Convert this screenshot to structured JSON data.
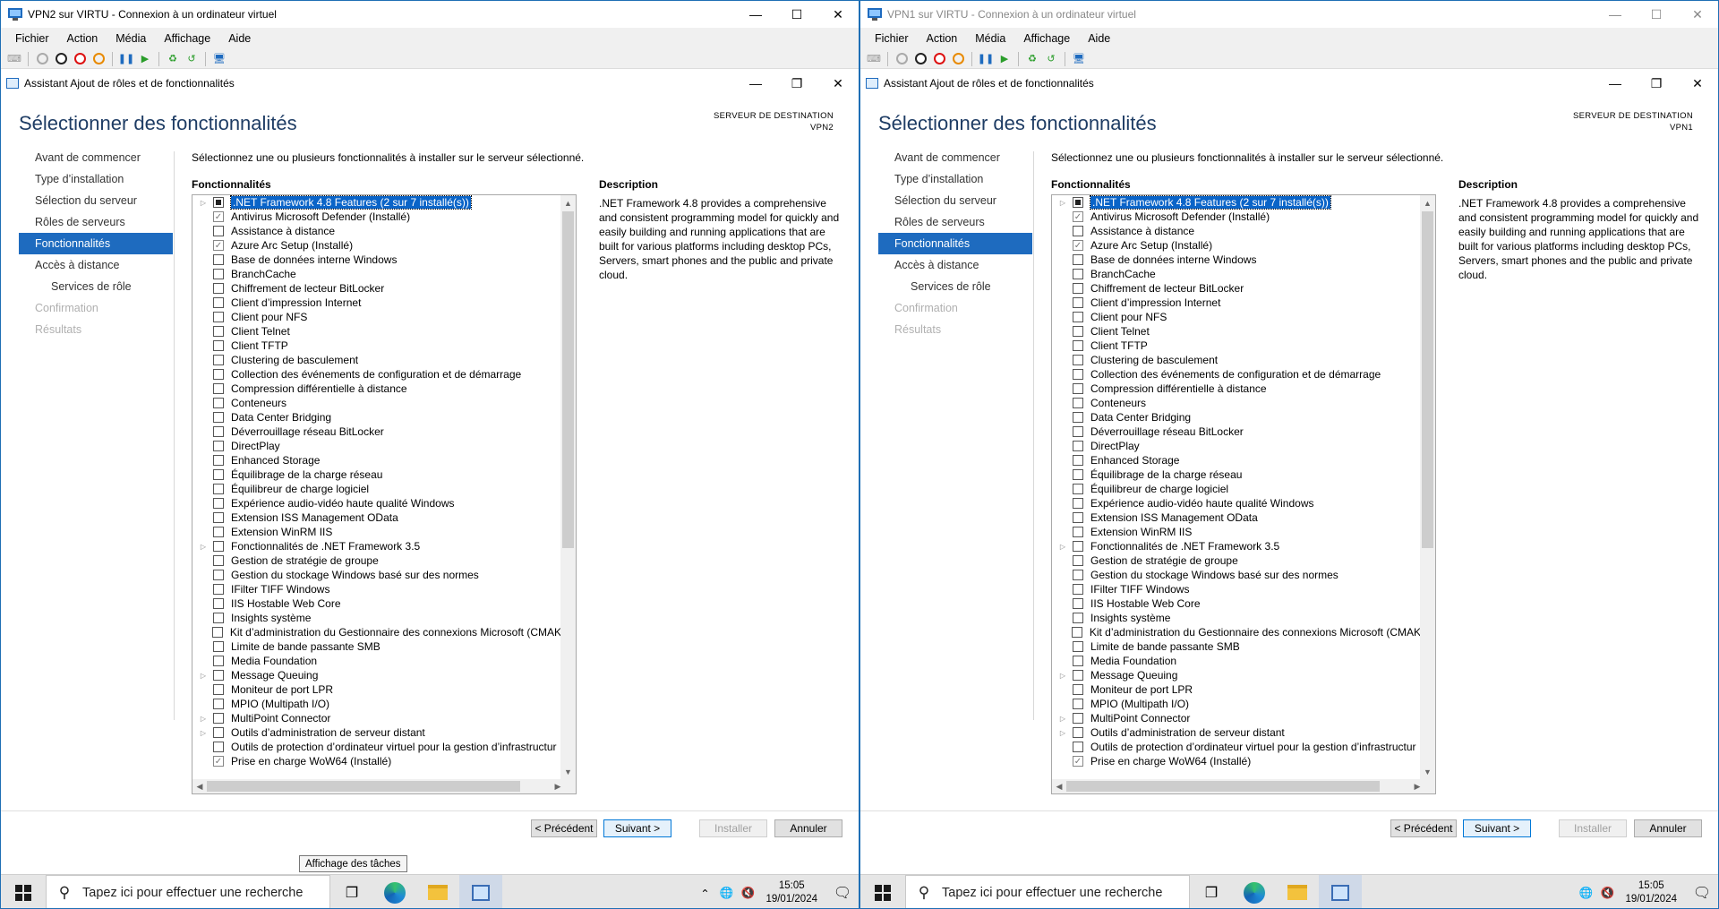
{
  "vm_windows": [
    {
      "title": "VPN2 sur VIRTU - Connexion à un ordinateur virtuel",
      "dest_value": "VPN2",
      "clock_time": "15:05",
      "clock_date": "19/01/2024"
    },
    {
      "title": "VPN1 sur VIRTU - Connexion à un ordinateur virtuel",
      "dest_value": "VPN1",
      "clock_time": "15:05",
      "clock_date": "19/01/2024"
    }
  ],
  "menu": [
    "Fichier",
    "Action",
    "Média",
    "Affichage",
    "Aide"
  ],
  "wizard": {
    "title": "Assistant Ajout de rôles et de fonctionnalités",
    "page_title": "Sélectionner des fonctionnalités",
    "dest_label": "SERVEUR DE DESTINATION",
    "intro": "Sélectionnez une ou plusieurs fonctionnalités à installer sur le serveur sélectionné.",
    "features_heading": "Fonctionnalités",
    "description_heading": "Description",
    "description": ".NET Framework 4.8 provides a comprehensive and consistent programming model for quickly and easily building and running applications that are built for various platforms including desktop PCs, Servers, smart phones and the public and private cloud.",
    "nav": [
      {
        "label": "Avant de commencer",
        "state": "normal"
      },
      {
        "label": "Type d’installation",
        "state": "normal"
      },
      {
        "label": "Sélection du serveur",
        "state": "normal"
      },
      {
        "label": "Rôles de serveurs",
        "state": "normal"
      },
      {
        "label": "Fonctionnalités",
        "state": "active"
      },
      {
        "label": "Accès à distance",
        "state": "normal"
      },
      {
        "label": "Services de rôle",
        "state": "sub"
      },
      {
        "label": "Confirmation",
        "state": "disabled"
      },
      {
        "label": "Résultats",
        "state": "disabled"
      }
    ],
    "features": [
      {
        "label": ".NET Framework 4.8 Features (2 sur 7 installé(s))",
        "check": "partial",
        "expand": true,
        "selected": true
      },
      {
        "label": "Antivirus Microsoft Defender (Installé)",
        "check": "installed",
        "expand": false
      },
      {
        "label": "Assistance à distance",
        "check": "none",
        "expand": false
      },
      {
        "label": "Azure Arc Setup (Installé)",
        "check": "installed",
        "expand": false
      },
      {
        "label": "Base de données interne Windows",
        "check": "none",
        "expand": false
      },
      {
        "label": "BranchCache",
        "check": "none",
        "expand": false
      },
      {
        "label": "Chiffrement de lecteur BitLocker",
        "check": "none",
        "expand": false
      },
      {
        "label": "Client d’impression Internet",
        "check": "none",
        "expand": false
      },
      {
        "label": "Client pour NFS",
        "check": "none",
        "expand": false
      },
      {
        "label": "Client Telnet",
        "check": "none",
        "expand": false
      },
      {
        "label": "Client TFTP",
        "check": "none",
        "expand": false
      },
      {
        "label": "Clustering de basculement",
        "check": "none",
        "expand": false
      },
      {
        "label": "Collection des événements de configuration et de démarrage",
        "check": "none",
        "expand": false
      },
      {
        "label": "Compression différentielle à distance",
        "check": "none",
        "expand": false
      },
      {
        "label": "Conteneurs",
        "check": "none",
        "expand": false
      },
      {
        "label": "Data Center Bridging",
        "check": "none",
        "expand": false
      },
      {
        "label": "Déverrouillage réseau BitLocker",
        "check": "none",
        "expand": false
      },
      {
        "label": "DirectPlay",
        "check": "none",
        "expand": false
      },
      {
        "label": "Enhanced Storage",
        "check": "none",
        "expand": false
      },
      {
        "label": "Équilibrage de la charge réseau",
        "check": "none",
        "expand": false
      },
      {
        "label": "Équilibreur de charge logiciel",
        "check": "none",
        "expand": false
      },
      {
        "label": "Expérience audio-vidéo haute qualité Windows",
        "check": "none",
        "expand": false
      },
      {
        "label": "Extension ISS Management OData",
        "check": "none",
        "expand": false
      },
      {
        "label": "Extension WinRM IIS",
        "check": "none",
        "expand": false
      },
      {
        "label": "Fonctionnalités de .NET Framework 3.5",
        "check": "none",
        "expand": true
      },
      {
        "label": "Gestion de stratégie de groupe",
        "check": "none",
        "expand": false
      },
      {
        "label": "Gestion du stockage Windows basé sur des normes",
        "check": "none",
        "expand": false
      },
      {
        "label": "IFilter TIFF Windows",
        "check": "none",
        "expand": false
      },
      {
        "label": "IIS Hostable Web Core",
        "check": "none",
        "expand": false
      },
      {
        "label": "Insights système",
        "check": "none",
        "expand": false
      },
      {
        "label": "Kit d’administration du Gestionnaire des connexions Microsoft (CMAK",
        "check": "none",
        "expand": false
      },
      {
        "label": "Limite de bande passante SMB",
        "check": "none",
        "expand": false
      },
      {
        "label": "Media Foundation",
        "check": "none",
        "expand": false
      },
      {
        "label": "Message Queuing",
        "check": "none",
        "expand": true
      },
      {
        "label": "Moniteur de port LPR",
        "check": "none",
        "expand": false
      },
      {
        "label": "MPIO (Multipath I/O)",
        "check": "none",
        "expand": false
      },
      {
        "label": "MultiPoint Connector",
        "check": "none",
        "expand": true
      },
      {
        "label": "Outils d’administration de serveur distant",
        "check": "none",
        "expand": true
      },
      {
        "label": "Outils de protection d’ordinateur virtuel pour la gestion d’infrastructur",
        "check": "none",
        "expand": false
      },
      {
        "label": "Prise en charge WoW64 (Installé)",
        "check": "installed",
        "expand": false
      }
    ],
    "buttons": {
      "prev": "< Précédent",
      "next": "Suivant >",
      "install": "Installer",
      "cancel": "Annuler"
    }
  },
  "taskbar": {
    "search_placeholder": "Tapez ici pour effectuer une recherche",
    "tooltip": "Affichage des tâches"
  },
  "colors": {
    "accent": "#1e6bbf",
    "title_text": "#1e3c64",
    "selection": "#0a64c8"
  }
}
